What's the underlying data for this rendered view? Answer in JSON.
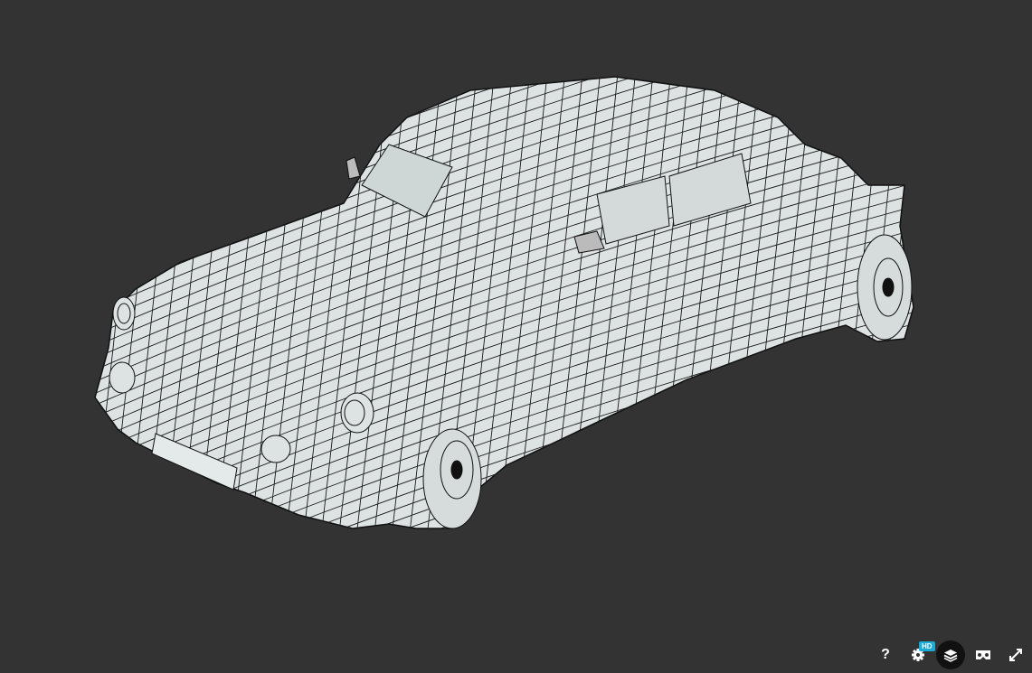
{
  "viewer": {
    "model": "wireframe-car",
    "background": "#333333"
  },
  "controls": {
    "help_label": "?",
    "hd_badge": "HD",
    "hd_color": "#1caad9",
    "items": [
      "help-icon",
      "settings-icon",
      "layers-icon",
      "vr-icon",
      "fullscreen-icon"
    ]
  }
}
